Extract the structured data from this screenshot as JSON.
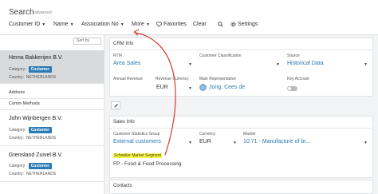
{
  "search": {
    "label": "Search",
    "advanced": "advanced"
  },
  "filters": {
    "customer_id": "Customer ID",
    "name": "Name",
    "association_no": "Association No",
    "more": "More",
    "favorites": "Favorites",
    "clear": "Clear",
    "settings": "Settings"
  },
  "list": {
    "sort_by": "Sort by",
    "items": [
      {
        "name": "Hema Bakkerijen B.V.",
        "category_label": "Category:",
        "category": "Customer",
        "country_label": "Country:",
        "country": "NETHERLANDS"
      },
      {
        "name": "John Wijnbergen B.V.",
        "category_label": "Category:",
        "category": "Customer",
        "country_label": "Country:",
        "country": "NETHERLANDS"
      },
      {
        "name": "Grensland Zuivel B.V.",
        "category_label": "Category:",
        "category": "Customer",
        "country_label": "Country:",
        "country": "NETHERLANDS"
      }
    ],
    "sub_links": [
      "Address",
      "Comm Methods"
    ]
  },
  "crm": {
    "title": "CRM Info",
    "rtm_label": "RTM",
    "rtm_value": "Area Sales",
    "classification_label": "Customer Classification",
    "source_label": "Source",
    "source_value": "Historical Data",
    "annual_revenue_label": "Annual Revenue",
    "revenue_currency_label": "Revenue Currency",
    "revenue_currency_value": "EUR",
    "main_rep_label": "Main Representative",
    "main_rep_initials": "JC",
    "main_rep_value": "Jong, Cees de",
    "key_account_label": "Key Account"
  },
  "sales": {
    "title": "Sales Info",
    "stat_group_label": "Customer Statistics Group",
    "stat_group_value": "External customers",
    "currency_label": "Currency",
    "currency_value": "EUR",
    "market_label": "Market",
    "market_value": "10.71 - Manufacture of br...",
    "market_segment_label": "Schoeller Market Segment",
    "market_segment_value": "FP - Food & Food Processing"
  },
  "contacts": {
    "title": "Contacts"
  },
  "colors": {
    "accent": "#2b79b5",
    "highlight": "#fdfb3a",
    "annotation": "#d33a2c"
  }
}
